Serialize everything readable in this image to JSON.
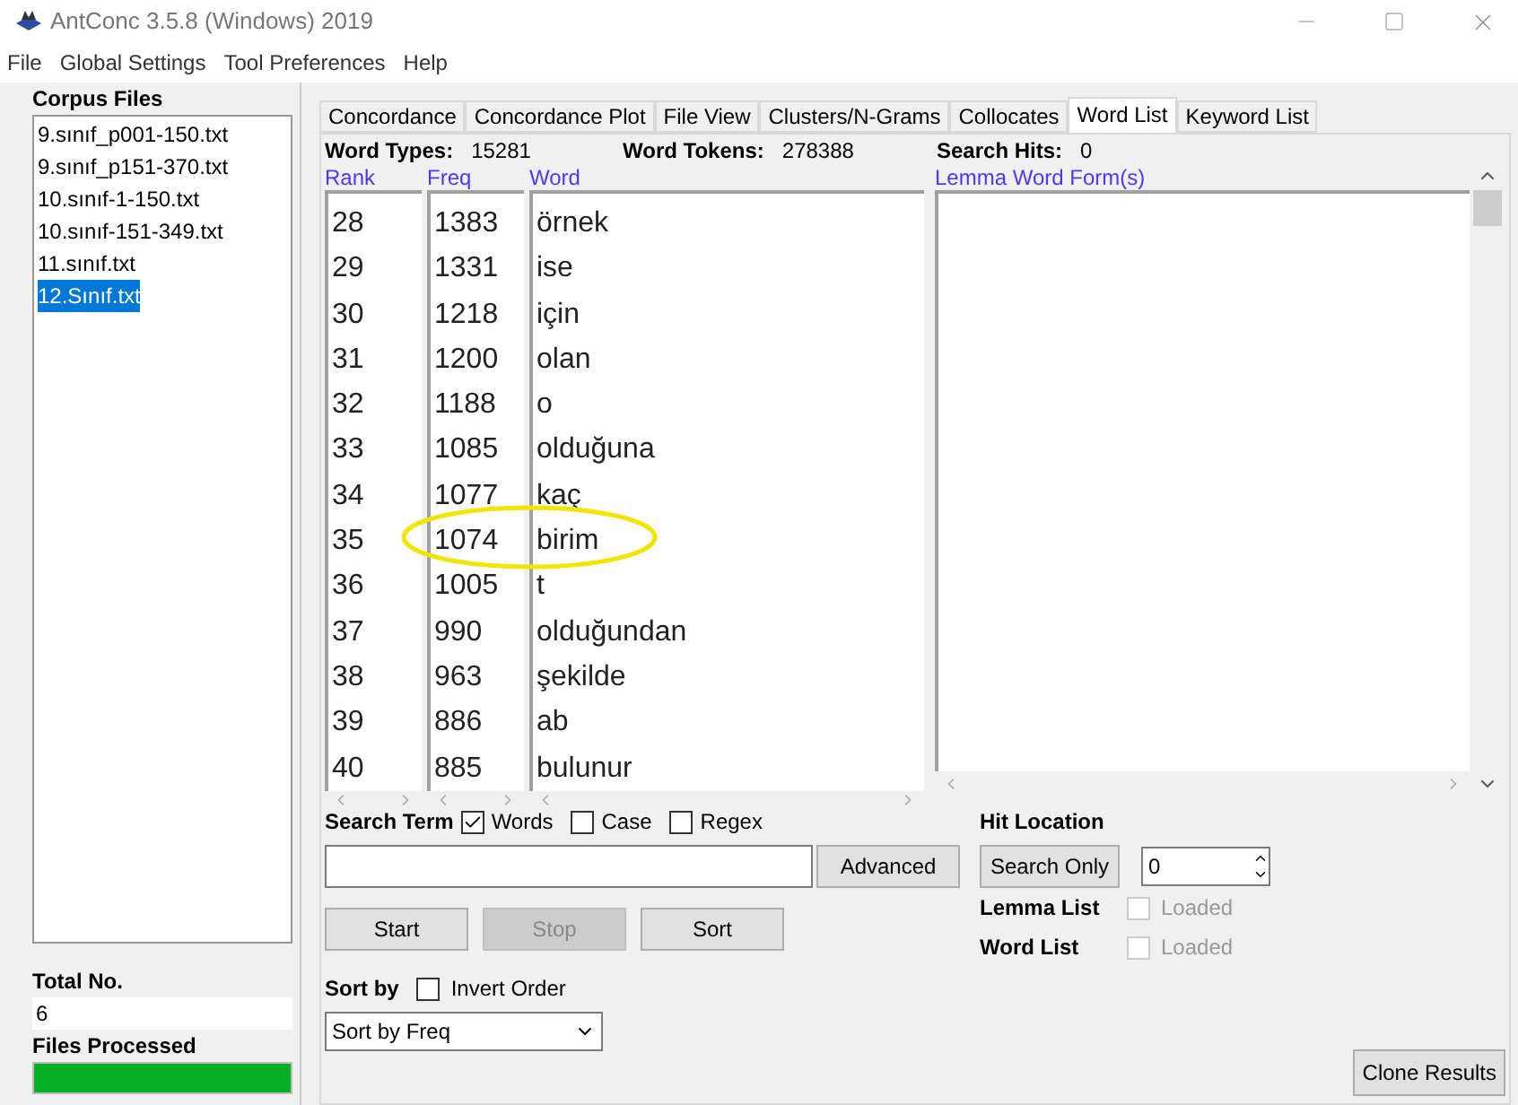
{
  "window": {
    "title": "AntConc 3.5.8 (Windows) 2019"
  },
  "menu": [
    "File",
    "Global Settings",
    "Tool Preferences",
    "Help"
  ],
  "corpus_files": {
    "title": "Corpus Files",
    "items": [
      {
        "label": "9.sınıf_p001-150.txt",
        "selected": false
      },
      {
        "label": "9.sınıf_p151-370.txt",
        "selected": false
      },
      {
        "label": "10.sınıf-1-150.txt",
        "selected": false
      },
      {
        "label": "10.sınıf-151-349.txt",
        "selected": false
      },
      {
        "label": "11.sınıf.txt",
        "selected": false
      },
      {
        "label": "12.Sınıf.txt",
        "selected": true
      }
    ]
  },
  "total": {
    "label": "Total No.",
    "value": "6"
  },
  "files_processed": {
    "label": "Files Processed",
    "level": 1
  },
  "tabs": [
    {
      "label": "Concordance",
      "selected": false
    },
    {
      "label": "Concordance Plot",
      "selected": false
    },
    {
      "label": "File View",
      "selected": false
    },
    {
      "label": "Clusters/N-Grams",
      "selected": false
    },
    {
      "label": "Collocates",
      "selected": false
    },
    {
      "label": "Word List",
      "selected": true
    },
    {
      "label": "Keyword List",
      "selected": false
    }
  ],
  "stats": [
    {
      "label": "Word Types:",
      "value": "15281"
    },
    {
      "label": "Word Tokens:",
      "value": "278388"
    },
    {
      "label": "Search Hits:",
      "value": "0"
    }
  ],
  "columns": [
    "Rank",
    "Freq",
    "Word",
    "Lemma Word Form(s)"
  ],
  "rows": [
    {
      "rank": "28",
      "freq": "1383",
      "word": "örnek",
      "circled": false
    },
    {
      "rank": "29",
      "freq": "1331",
      "word": "ise",
      "circled": false
    },
    {
      "rank": "30",
      "freq": "1218",
      "word": "için",
      "circled": false
    },
    {
      "rank": "31",
      "freq": "1200",
      "word": "olan",
      "circled": false
    },
    {
      "rank": "32",
      "freq": "1188",
      "word": "o",
      "circled": false
    },
    {
      "rank": "33",
      "freq": "1085",
      "word": "olduğuna",
      "circled": false
    },
    {
      "rank": "34",
      "freq": "1077",
      "word": "kaç",
      "circled": false
    },
    {
      "rank": "35",
      "freq": "1074",
      "word": "birim",
      "circled": true
    },
    {
      "rank": "36",
      "freq": "1005",
      "word": "t",
      "circled": false
    },
    {
      "rank": "37",
      "freq": "990",
      "word": "olduğundan",
      "circled": false
    },
    {
      "rank": "38",
      "freq": "963",
      "word": "şekilde",
      "circled": false
    },
    {
      "rank": "39",
      "freq": "886",
      "word": "ab",
      "circled": false
    },
    {
      "rank": "40",
      "freq": "885",
      "word": "bulunur",
      "circled": false
    }
  ],
  "search": {
    "label": "Search Term",
    "options": [
      {
        "label": "Words",
        "checked": true
      },
      {
        "label": "Case",
        "checked": false
      },
      {
        "label": "Regex",
        "checked": false
      }
    ],
    "advanced": "Advanced"
  },
  "actions": [
    {
      "label": "Start",
      "disabled": false
    },
    {
      "label": "Stop",
      "disabled": true
    },
    {
      "label": "Sort",
      "disabled": false
    }
  ],
  "sort": {
    "label": "Sort by",
    "invert_label": "Invert Order",
    "invert_checked": false,
    "value": "Sort by Freq"
  },
  "hit_location": {
    "label": "Hit Location",
    "button": "Search Only",
    "value": "0"
  },
  "loaded": [
    {
      "label": "Lemma List",
      "text": "Loaded",
      "checked": false
    },
    {
      "label": "Word List",
      "text": "Loaded",
      "checked": false
    }
  ],
  "clone": "Clone Results"
}
